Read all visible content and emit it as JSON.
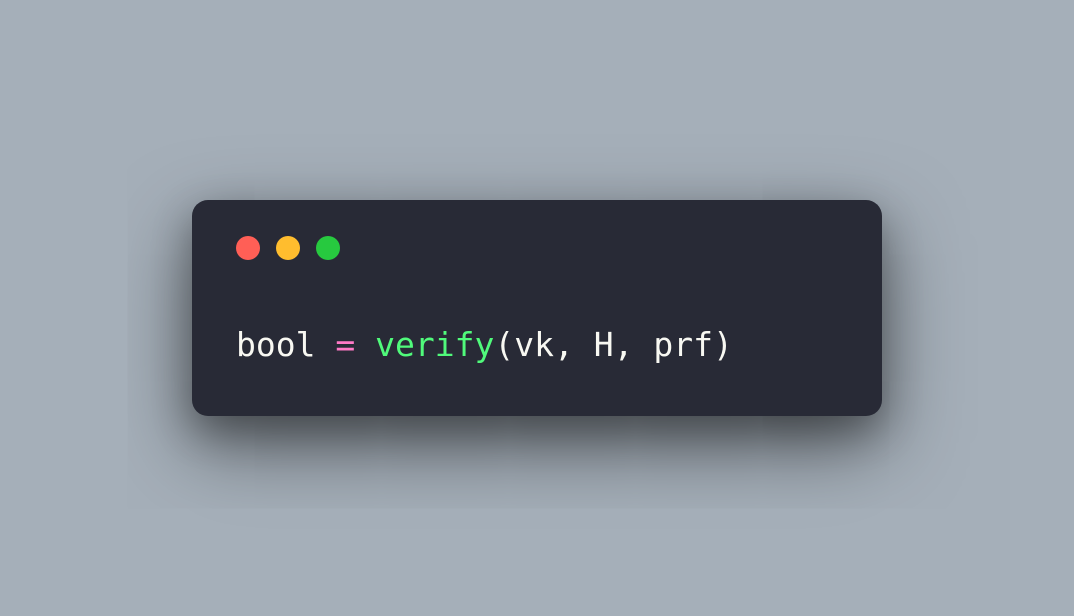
{
  "window": {
    "traffic_lights": {
      "red": "close",
      "yellow": "minimize",
      "green": "zoom"
    }
  },
  "code": {
    "line1": {
      "variable": "bool",
      "space1": " ",
      "operator": "=",
      "space2": " ",
      "function": "verify",
      "open_paren": "(",
      "arg1": "vk",
      "comma1": ",",
      "space3": " ",
      "arg2": "H",
      "comma2": ",",
      "space4": " ",
      "arg3": "prf",
      "close_paren": ")"
    }
  }
}
